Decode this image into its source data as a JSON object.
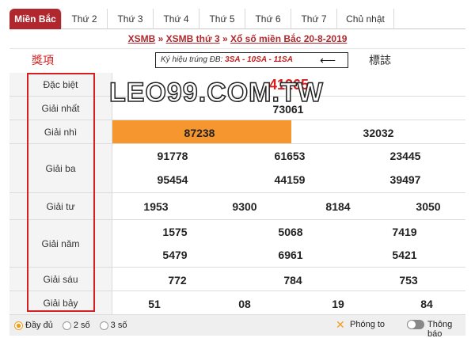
{
  "tabs": [
    "Miền Bắc",
    "Thứ 2",
    "Thứ 3",
    "Thứ 4",
    "Thứ 5",
    "Thứ 6",
    "Thứ 7",
    "Chủ nhật"
  ],
  "header": {
    "link1": "XSMB",
    "sep": "»",
    "link2": "XSMB thứ 3",
    "link3": "Xổ số miền Bắc 20-8-2019"
  },
  "annotations": {
    "left": "獎項",
    "right": "標誌",
    "watermark": "LEO99.COM.TW"
  },
  "kyhieu": {
    "label": "Ký hiệu trúng ĐB: ",
    "codes": "3SA - 10SA - 11SA"
  },
  "prizes": {
    "db": {
      "label": "Đặc biệt",
      "values": [
        "41265"
      ]
    },
    "g1": {
      "label": "Giải nhất",
      "values": [
        "73061"
      ]
    },
    "g2": {
      "label": "Giải nhì",
      "values": [
        "87238",
        "32032"
      ]
    },
    "g3": {
      "label": "Giải ba",
      "values": [
        "91778",
        "61653",
        "23445",
        "95454",
        "44159",
        "39497"
      ]
    },
    "g4": {
      "label": "Giải tư",
      "values": [
        "1953",
        "9300",
        "8184",
        "3050"
      ]
    },
    "g5": {
      "label": "Giải năm",
      "values": [
        "1575",
        "5068",
        "7419",
        "5479",
        "6961",
        "5421"
      ]
    },
    "g6": {
      "label": "Giải sáu",
      "values": [
        "772",
        "784",
        "753"
      ]
    },
    "g7": {
      "label": "Giải bảy",
      "values": [
        "51",
        "08",
        "19",
        "84"
      ]
    }
  },
  "footer": {
    "opt1": "Đầy đủ",
    "opt2": "2 số",
    "opt3": "3 số",
    "zoom": "Phóng to",
    "notify": "Thông báo"
  },
  "colors": {
    "brand": "#b0272e",
    "highlight": "#f5962e",
    "special": "#d81f1f"
  }
}
